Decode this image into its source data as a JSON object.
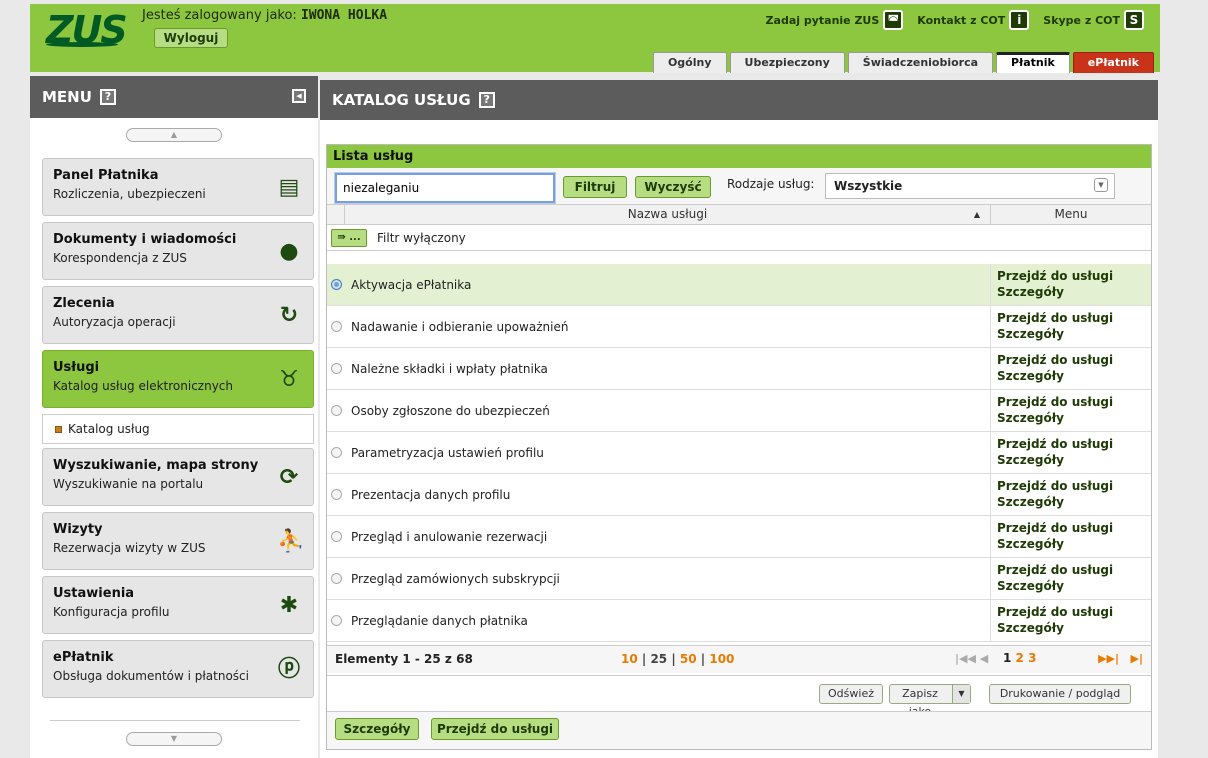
{
  "header": {
    "logo": "ZUS",
    "logged_prefix": "Jesteś zalogowany jako:",
    "logged_user": "IWONA HOLKA",
    "logout": "Wyloguj",
    "links": [
      {
        "label": "Zadaj pytanie ZUS",
        "icon": "chat-icon"
      },
      {
        "label": "Kontakt z COT",
        "icon": "info-icon"
      },
      {
        "label": "Skype z COT",
        "icon": "skype-icon"
      }
    ],
    "tabs": [
      "Ogólny",
      "Ubezpieczony",
      "Świadczeniobiorca",
      "Płatnik",
      "ePłatnik"
    ],
    "active_tab": "Płatnik"
  },
  "sidebar": {
    "title": "MENU",
    "help": "?",
    "items": [
      {
        "title": "Panel Płatnika",
        "subtitle": "Rozliczenia, ubezpieczeni",
        "icon": "panel-icon"
      },
      {
        "title": "Dokumenty i wiadomości",
        "subtitle": "Korespondencja z ZUS",
        "icon": "speech-bubble-icon"
      },
      {
        "title": "Zlecenia",
        "subtitle": "Autoryzacja operacji",
        "icon": "refresh-icon"
      },
      {
        "title": "Usługi",
        "subtitle": "Katalog usług elektronicznych",
        "icon": "services-icon"
      },
      {
        "title": "Wyszukiwanie, mapa strony",
        "subtitle": "Wyszukiwanie na portalu",
        "icon": "search-sync-icon"
      },
      {
        "title": "Wizyty",
        "subtitle": "Rezerwacja wizyty w ZUS",
        "icon": "walking-person-icon"
      },
      {
        "title": "Ustawienia",
        "subtitle": "Konfiguracja profilu",
        "icon": "puzzle-icon"
      },
      {
        "title": "ePłatnik",
        "subtitle": "Obsługa dokumentów i płatności",
        "icon": "eplatnik-icon"
      }
    ],
    "active_item": "Usługi",
    "subitem": "Katalog usług"
  },
  "main": {
    "title": "KATALOG USŁUG",
    "help": "?",
    "panel_title": "Lista usług",
    "search_value": "niezaleganiu",
    "filter_btn": "Filtruj",
    "clear_btn": "Wyczyść",
    "types_label": "Rodzaje usług:",
    "types_value": "Wszystkie",
    "col_name": "Nazwa usługi",
    "col_menu": "Menu",
    "filter_toggle": "...",
    "filter_state": "Filtr wyłączony",
    "row_action_go": "Przejdź do usługi",
    "row_action_details": "Szczegóły",
    "rows": [
      "Aktywacja ePłatnika",
      "Nadawanie i odbieranie upoważnień",
      "Należne składki i wpłaty płatnika",
      "Osoby zgłoszone do ubezpieczeń",
      "Parametryzacja ustawień profilu",
      "Prezentacja danych profilu",
      "Przegląd i anulowanie rezerwacji",
      "Przegląd zamówionych subskrypcji",
      "Przeglądanie danych płatnika"
    ],
    "selected_row": 0,
    "pager": {
      "elements": "Elementy 1 - 25 z 68",
      "sizes": [
        "10",
        "25",
        "50",
        "100"
      ],
      "current_size": "25",
      "pages": [
        "1",
        "2",
        "3"
      ],
      "current_page": "1"
    },
    "refresh": "Odśwież",
    "save_as": "Zapisz jako",
    "print": "Drukowanie / podgląd",
    "details_btn": "Szczegóły",
    "go_btn": "Przejdź do usługi"
  },
  "colors": {
    "brand_green": "#8dc63f",
    "dark_green": "#005a24",
    "header_gray": "#5c5c5c",
    "eplatnik_red": "#c8331a",
    "accent_orange": "#e87a00"
  }
}
